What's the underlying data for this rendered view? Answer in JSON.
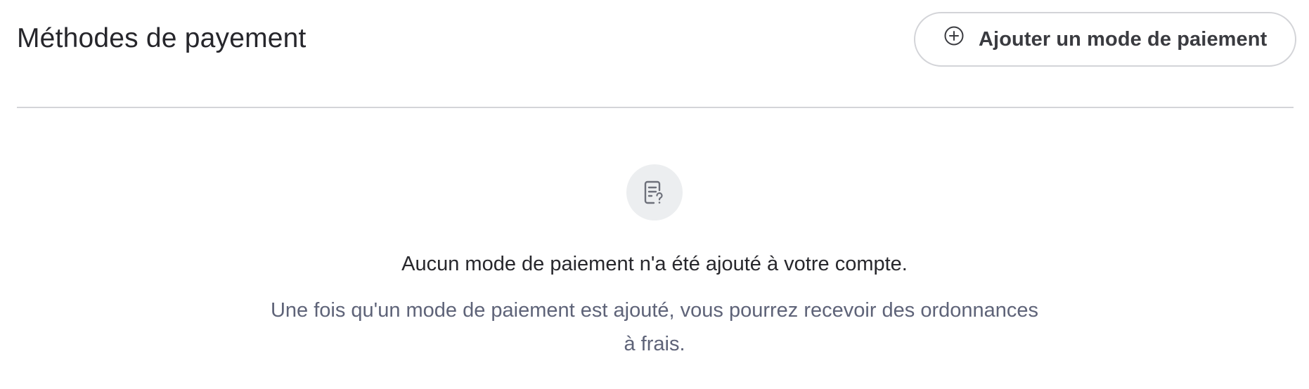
{
  "header": {
    "title": "Méthodes de payement",
    "add_button_label": "Ajouter un mode de paiement",
    "add_button_icon": "plus-circle-icon"
  },
  "empty_state": {
    "icon": "document-question-icon",
    "title": "Aucun mode de paiement n'a été ajouté à votre compte.",
    "description": "Une fois qu'un mode de paiement est ajouté, vous pourrez recevoir des ordonnances à frais."
  },
  "colors": {
    "title_text": "#26262b",
    "description_text": "#5e6378",
    "border": "#d3d4d8",
    "icon_bg": "#eceef0"
  }
}
